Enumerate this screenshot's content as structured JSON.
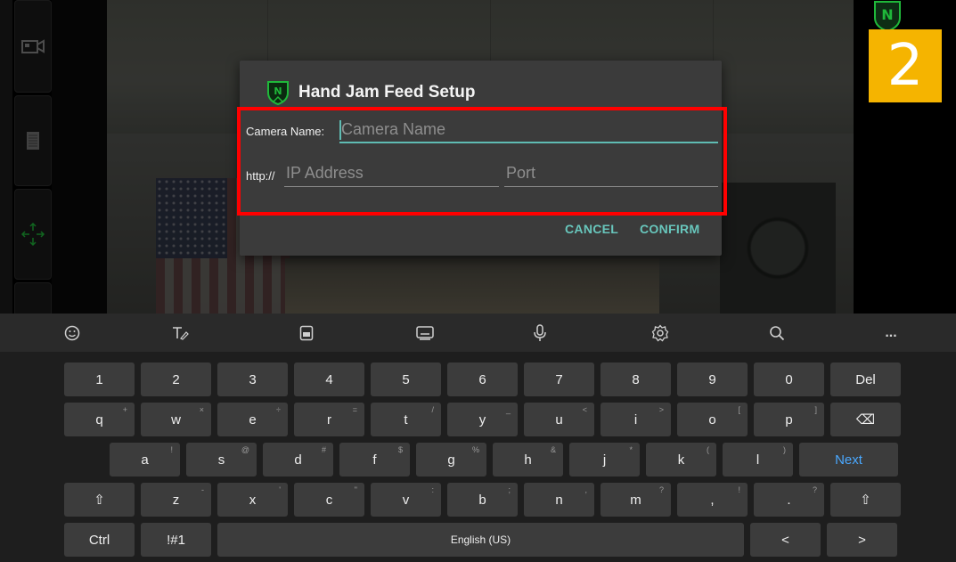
{
  "dialog": {
    "title": "Hand Jam Feed Setup",
    "camera_label": "Camera Name:",
    "camera_placeholder": "Camera Name",
    "http_label": "http://",
    "ip_placeholder": "IP Address",
    "port_placeholder": "Port",
    "cancel_label": "CANCEL",
    "confirm_label": "CONFIRM"
  },
  "badge": {
    "text": "2",
    "color": "#f5b400"
  },
  "logo": {
    "letter": "N",
    "color": "#1fb83a"
  },
  "keyboard": {
    "toolbar_icons": [
      "emoji-icon",
      "handwriting-icon",
      "clipboard-icon",
      "keyboard-icon",
      "microphone-icon",
      "settings-icon",
      "search-icon",
      "more-icon"
    ],
    "more_glyph": "...",
    "rows": [
      [
        {
          "label": "1"
        },
        {
          "label": "2"
        },
        {
          "label": "3"
        },
        {
          "label": "4"
        },
        {
          "label": "5"
        },
        {
          "label": "6"
        },
        {
          "label": "7"
        },
        {
          "label": "8"
        },
        {
          "label": "9"
        },
        {
          "label": "0"
        },
        {
          "label": "Del"
        }
      ],
      [
        {
          "label": "q",
          "hint": "+"
        },
        {
          "label": "w",
          "hint": "×"
        },
        {
          "label": "e",
          "hint": "÷"
        },
        {
          "label": "r",
          "hint": "="
        },
        {
          "label": "t",
          "hint": "/"
        },
        {
          "label": "y",
          "hint": "_"
        },
        {
          "label": "u",
          "hint": "<"
        },
        {
          "label": "i",
          "hint": ">"
        },
        {
          "label": "o",
          "hint": "["
        },
        {
          "label": "p",
          "hint": "]"
        },
        {
          "label": "⌫"
        }
      ],
      [
        {
          "label": "a",
          "hint": "!"
        },
        {
          "label": "s",
          "hint": "@"
        },
        {
          "label": "d",
          "hint": "#"
        },
        {
          "label": "f",
          "hint": "$"
        },
        {
          "label": "g",
          "hint": "%"
        },
        {
          "label": "h",
          "hint": "&"
        },
        {
          "label": "j",
          "hint": "*"
        },
        {
          "label": "k",
          "hint": "("
        },
        {
          "label": "l",
          "hint": ")"
        },
        {
          "label": "Next"
        }
      ],
      [
        {
          "label": "⇧"
        },
        {
          "label": "z",
          "hint": "-"
        },
        {
          "label": "x",
          "hint": "'"
        },
        {
          "label": "c",
          "hint": "\""
        },
        {
          "label": "v",
          "hint": ":"
        },
        {
          "label": "b",
          "hint": ";"
        },
        {
          "label": "n",
          "hint": ","
        },
        {
          "label": "m",
          "hint": "?"
        },
        {
          "label": ",",
          "hint": "!"
        },
        {
          "label": ".",
          "hint": "?"
        },
        {
          "label": "⇧"
        }
      ],
      [
        {
          "label": "Ctrl"
        },
        {
          "label": "!#1"
        },
        {
          "label": "English (US)"
        },
        {
          "label": "<"
        },
        {
          "label": ">"
        }
      ]
    ]
  }
}
